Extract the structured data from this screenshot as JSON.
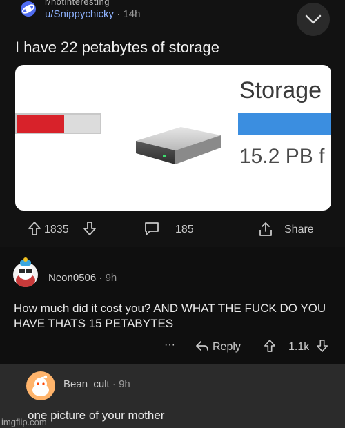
{
  "post": {
    "subreddit": "r/notinteresting",
    "author": "u/Snippychicky",
    "separator": "·",
    "age": "14h",
    "title": "I have 22 petabytes of storage",
    "image": {
      "storage_label": "Storage",
      "capacity_text": "15.2 PB f",
      "red_bar_fill_fraction": 0.57,
      "colors": {
        "red": "#d8222a",
        "blue": "#3b8ee0"
      }
    },
    "actions": {
      "upvotes": "1835",
      "comments": "185",
      "share": "Share"
    },
    "menu_icon": "chevron-down-icon"
  },
  "comments": [
    {
      "author": "Neon0506",
      "separator": "·",
      "age": "9h",
      "body": "How much did it cost you? AND WHAT THE FUCK DO YOU HAVE THATS 15 PETABYTES",
      "more": "···",
      "reply": "Reply",
      "votes": "1.1k"
    },
    {
      "author": "Bean_cult",
      "separator": "·",
      "age": "9h",
      "body": "one picture of your mother"
    }
  ],
  "watermark": "imgflip.com"
}
